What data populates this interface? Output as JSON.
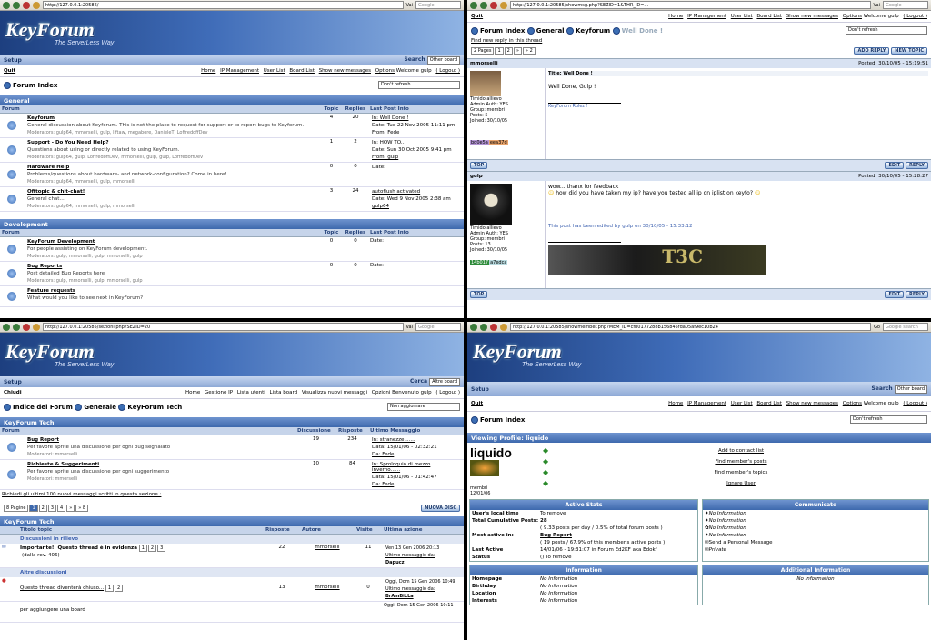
{
  "p1": {
    "url": "http://127.0.0.1:20586/",
    "vai": "Vai",
    "google": "Google",
    "logo": "KeyForum",
    "tagline": "The ServerLess Way",
    "setup": "Setup",
    "search": "Search",
    "search_sel": "Other board",
    "quit": "Quit",
    "links": [
      "Home",
      "IP Management",
      "User List",
      "Board List",
      "Show new messages",
      "Options"
    ],
    "welcome": "Welcome gulp",
    "logout": "( Logout )",
    "crumb": "Forum Index",
    "refresh": "Don't refresh",
    "cat1": "General",
    "cat2": "Development",
    "cols": [
      "Forum",
      "Topic",
      "Replies",
      "Last Post Info"
    ],
    "rows": [
      {
        "name": "Keyforum",
        "desc": "General discussion about Keyforum. This is not the place to request for support or to report bugs to Keyforum.",
        "mod": "Moderators: gulp64, mmorselli, gulp, liftaw, megabore, DanieleT, LoffredoffDev",
        "topic": "4",
        "replies": "20",
        "l1": "In: Well Done !",
        "l2": "Date: Tue 22 Nov 2005 11:11 pm",
        "l3": "From: Fede"
      },
      {
        "name": "Support - Do You Need Help?",
        "desc": "Questions about using or directly related to using KeyForum.",
        "mod": "Moderators: gulp64, gulp, LoffredoffDev, mmorselli, gulp, gulp, LoffredoffDev",
        "topic": "1",
        "replies": "2",
        "l1": "In: HOW TO...",
        "l2": "Date: Sun 30 Oct 2005 9:41 pm",
        "l3": "From: gulp"
      },
      {
        "name": "Hardware Help",
        "desc": "Problems/questions about hardware- and network-configuration? Come in here!",
        "mod": "Moderators: gulp64, mmorselli, gulp, mmorselli",
        "topic": "0",
        "replies": "0",
        "l1": "",
        "l2": "Date:",
        "l3": ""
      },
      {
        "name": "Offtopic & chit-chat!",
        "desc": "General chat...",
        "mod": "Moderators: gulp64, mmorselli, gulp, mmorselli",
        "topic": "3",
        "replies": "24",
        "l1": "autoflush activated",
        "l2": "Date: Wed 9 Nov 2005 2:38 am",
        "l3": "gulp64"
      }
    ],
    "rows2": [
      {
        "name": "KeyForum Development",
        "desc": "For people assisting on KeyForum development.",
        "mod": "Moderators: gulp, mmorselli, gulp, mmorselli, gulp",
        "topic": "0",
        "replies": "0",
        "l2": "Date:"
      },
      {
        "name": "Bug Reports",
        "desc": "Post detailed Bug Reports here",
        "mod": "Moderators: gulp, mmorselli, gulp, mmorselli, gulp",
        "topic": "0",
        "replies": "0",
        "l2": "Date:"
      },
      {
        "name": "Feature requests",
        "desc": "What would you like to see next in KeyForum?",
        "mod": "",
        "topic": "",
        "replies": "",
        "l2": ""
      }
    ]
  },
  "p2": {
    "url": "http://127.0.0.1:20585/showmsg.php?SEZID=1&THR_ID=...",
    "vai": "Vai",
    "google": "Google",
    "quit": "Quit",
    "links": [
      "Home",
      "IP Management",
      "User List",
      "Board List",
      "Show new messages",
      "Options"
    ],
    "welcome": "Welcome gulp",
    "logout": "( Logout )",
    "crumb": [
      "Forum Index",
      "General",
      "Keyforum",
      "Well Done !"
    ],
    "find_new": "Find new reply in this thread",
    "refresh": "Don't refresh",
    "pages": "2 Pages",
    "pnums": [
      "1",
      "2",
      "»",
      "» 2"
    ],
    "add_reply": "ADD REPLY",
    "new_topic": "NEW TOPIC",
    "posts": [
      {
        "author": "mmorselli",
        "posted": "Posted: 30/10/05 - 15:19:51",
        "title": "Title: Well Done !",
        "body": "Well Done, Gulp !",
        "sig": "KeyForum Rulez !",
        "rank": "Timido allievo",
        "info": [
          "Admin Auth: YES",
          "Group: membri",
          "Posts: 5",
          "Joined: 30/10/05"
        ],
        "code1": "bd0e5a",
        "code2": "eea37d",
        "edited": ""
      },
      {
        "author": "gulp",
        "posted": "Posted: 30/10/05 - 15:28:27",
        "title": "",
        "body": "wow... thanx for feedback",
        "body2": "how did you have taken my ip? have you tested all ip on iplist on keyfo?",
        "sig": "",
        "rank": "Timido allievo",
        "info": [
          "Admin Auth: YES",
          "Group: membri",
          "Posts: 13",
          "Joined: 30/10/05"
        ],
        "code1": "14b017",
        "code2": "a7edca",
        "edited": "This post has been edited by gulp on 30/10/05 - 15:33:12"
      }
    ],
    "top": "TOP",
    "edit": "EDIT",
    "reply": "REPLY",
    "sigimg": "T3C"
  },
  "p3": {
    "url": "http://127.0.0.1:20585/sezioni.php?SEZID=20",
    "vai": "Vai",
    "google": "Google",
    "logo": "KeyForum",
    "tagline": "The ServerLess Way",
    "setup": "Setup",
    "search": "Cerca",
    "search_sel": "Altre board",
    "quit": "Chiudi",
    "links": [
      "Home",
      "Gestione IP",
      "Lista utenti",
      "Lista board",
      "Visualizza nuovi messaggi",
      "Opzioni"
    ],
    "welcome": "Benvenuto gulp",
    "logout": "( Logout )",
    "crumb": [
      "Indice del Forum",
      "Generale",
      "KeyForum Tech"
    ],
    "refresh": "Non aggiornare",
    "cat": "KeyForum Tech",
    "cols": [
      "Forum",
      "Discussione",
      "Risposte",
      "Ultimo Messaggio"
    ],
    "rows": [
      {
        "name": "Bug Report",
        "desc": "Per favore aprite una discussione per ogni bug segnalato",
        "mod": "Moderatori: mmorselli",
        "topic": "19",
        "replies": "234",
        "l1": "In: stranezze.......",
        "l2": "Data: 15/01/06 - 02:32:21",
        "l3": "Da: Fede"
      },
      {
        "name": "Richieste & Suggerimenti",
        "desc": "Per favore aprite una discussione per ogni suggerimento",
        "mod": "Moderatori: mmorselli",
        "topic": "10",
        "replies": "84",
        "l1": "In: Sproloquio di mezzo inverno......",
        "l2": "Data: 15/01/06 - 01:42:47",
        "l3": "Da: Fede"
      }
    ],
    "last100": "Richiedi gli ultimi 100 nuovi messaggi scritti in questa sezione.:",
    "pages": "8 Pagine",
    "pnums": [
      "1",
      "2",
      "3",
      "4",
      "»",
      "» 8"
    ],
    "new_disc": "NUOVA DISC",
    "tcols": [
      "Titolo topic",
      "Risposte",
      "Autore",
      "Visite",
      "Ultima azione"
    ],
    "sticky": "Discussioni in rilievo",
    "others": "Altre discussioni",
    "trows": [
      {
        "title": "Importante!: Questo thread è in evidenza",
        "sub": "(dalla rev. 406)",
        "pages": [
          "1",
          "2",
          "3"
        ],
        "rep": "22",
        "auth": "mmorselli",
        "vis": "11",
        "la1": "Ven 13 Gen 2006 20:13",
        "la2": "Ultimo messaggio da:",
        "la3": "Dapucz"
      },
      {
        "title": "Questo thread diventerà chiuso...",
        "sub": "",
        "pages": [
          "1",
          "2"
        ],
        "rep": "13",
        "auth": "mmorselli",
        "vis": "0",
        "la1": "Oggi, Dom 15 Gen 2006 10:49",
        "la2": "Ultimo messaggio da:",
        "la3": "BrAmBiLLa"
      },
      {
        "title": "per aggiungere una board",
        "sub": "",
        "pages": [],
        "rep": "",
        "auth": "",
        "vis": "",
        "la1": "Oggi, Dom 15 Gen 2006 10:11",
        "la2": "",
        "la3": ""
      }
    ]
  },
  "p4": {
    "url": "http://127.0.0.1:20585/showmember.php?MEM_ID=cfb0177288b156845fda05af9ec10b24",
    "vai": "Go",
    "google": "Google search",
    "logo": "KeyForum",
    "tagline": "The ServerLess Way",
    "setup": "Setup",
    "search": "Search",
    "search_sel": "Other board",
    "quit": "Quit",
    "links": [
      "Home",
      "IP Management",
      "User List",
      "Board List",
      "Show new messages",
      "Options"
    ],
    "welcome": "Welcome gulp",
    "logout": "( Logout )",
    "crumb": "Forum Index",
    "refresh": "Don't refresh",
    "viewing": "Viewing Profile: liquido",
    "name": "liquido",
    "group": "membri",
    "date": "12/01/06",
    "actions": [
      "Add to contact list",
      "Find member's posts",
      "Find member's topics",
      "Ignore User"
    ],
    "active_stats": "Active Stats",
    "communicate": "Communicate",
    "stats": [
      [
        "User's local time",
        "To remove"
      ],
      [
        "Total Cumulative Posts:",
        "28"
      ],
      [
        "",
        "( 9.33 posts per day / 0.5% of total forum posts )"
      ],
      [
        "Most active in:",
        "Bug Report"
      ],
      [
        "",
        "( 19 posts / 67.9% of this member's active posts )"
      ],
      [
        "Last Active",
        "14/01/06 - 19:31:07 in Forum Ed2KF aka Edokf"
      ],
      [
        "Status",
        "() To remove"
      ]
    ],
    "comm": [
      "No Information",
      "No Information",
      "No Information",
      "No Information",
      "Send a Personal Message",
      "Private"
    ],
    "info_h": "Information",
    "info": [
      [
        "Homepage",
        "No Information"
      ],
      [
        "Birthday",
        "No Information"
      ],
      [
        "Location",
        "No Information"
      ],
      [
        "Interests",
        "No Information"
      ]
    ],
    "add_info_h": "Additional Information",
    "add_info": "No Information"
  }
}
